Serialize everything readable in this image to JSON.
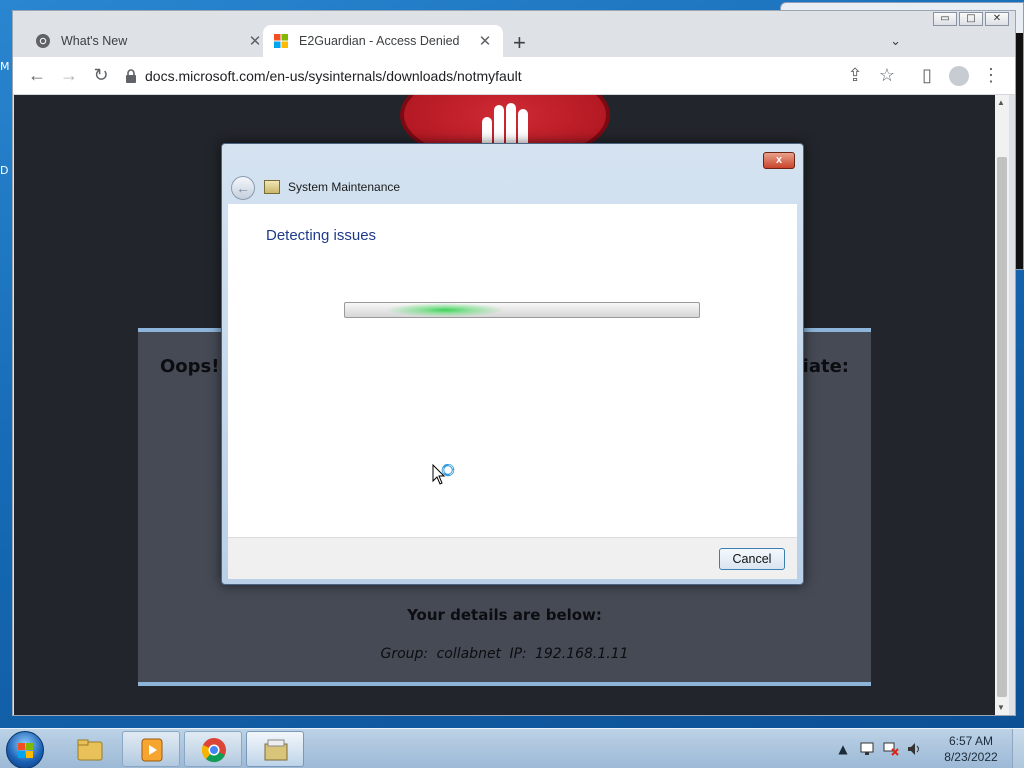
{
  "desktop": {
    "glimpse_top": "M",
    "glimpse_mid": "D"
  },
  "browser": {
    "window_controls": {
      "minimize": "▭",
      "maximize": "□",
      "close": "✕"
    },
    "tabs": [
      {
        "title": "What's New",
        "icon": "chrome-icon",
        "active": false
      },
      {
        "title": "E2Guardian - Access Denied",
        "icon": "microsoft-logo-icon",
        "active": true
      }
    ],
    "tab_close": "✕",
    "new_tab": "+",
    "tab_search": "⌄",
    "nav": {
      "back": "←",
      "forward": "→",
      "reload": "↻"
    },
    "url": "docs.microsoft.com/en-us/sysinternals/downloads/notmyfault",
    "toolbar_icons": {
      "share": "⇪",
      "bookmark": "☆",
      "sidepanel": "▯",
      "menu": "⋮"
    }
  },
  "page": {
    "oops_start": "Oops! Y",
    "oops_end": "riate:",
    "details_title": "Your details are below:",
    "details_line": "Group: collabnet  IP: 192.168.1.11"
  },
  "dialog": {
    "title": "System Maintenance",
    "close_label": "x",
    "heading": "Detecting issues",
    "cancel_label": "Cancel",
    "progress_style": "marquee"
  },
  "taskbar": {
    "tray_arrow": "▲",
    "clock_time": "6:57 AM",
    "clock_date": "8/23/2022"
  },
  "colors": {
    "dialog_heading": "#1e3b8a",
    "page_panel": "#454a55",
    "progress_glow": "#3ed25a",
    "stop_sign": "#c0202a"
  }
}
